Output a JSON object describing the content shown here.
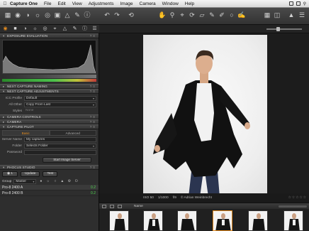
{
  "menubar": {
    "app_name": "Capture One",
    "items": [
      "File",
      "Edit",
      "View",
      "Adjustments",
      "Image",
      "Camera",
      "Window",
      "Help"
    ]
  },
  "panel": {
    "sections": {
      "exposure": "Exposure Evaluation",
      "capture_naming": "Next Capture Naming",
      "capture_adjustments": "Next Capture Adjustments",
      "camera_controls": "Camera Controls",
      "camera": "Camera",
      "capture_pilot": "Capture Pilot",
      "phocus": "Phocus Studio"
    },
    "adjustments": [
      {
        "label": "ICC Profile",
        "value": "Default"
      },
      {
        "label": "All Other",
        "value": "Copy From Last"
      },
      {
        "label": "Styles",
        "value": "None"
      }
    ],
    "pilot": {
      "tabs": [
        "Basic",
        "Advanced"
      ],
      "fields": [
        {
          "label": "Server Name",
          "value": "My captures"
        },
        {
          "label": "Folder",
          "value": "Selects Folder"
        },
        {
          "label": "Password",
          "value": ""
        }
      ],
      "start_button": "Start Image Server"
    },
    "studio": {
      "camera_count": "1",
      "update_button": "Update",
      "test_button": "Test",
      "group_label": "Group",
      "group_value": "Master",
      "cameras": [
        {
          "name": "Pro-8 2400 A",
          "count": "0.2"
        },
        {
          "name": "Pro-8 2400 B",
          "count": "0.2"
        }
      ]
    }
  },
  "viewer": {
    "caption": {
      "iso": "ISO 50",
      "shutter": "1/1000",
      "aperture": "f/9",
      "credit": "© Adrian Weinbrecht"
    }
  },
  "filmstrip": {
    "sort_label": "Name"
  },
  "colors": {
    "accent": "#e08a20",
    "panel_bg": "#2e2e2e",
    "status_green": "#4ed34e"
  }
}
